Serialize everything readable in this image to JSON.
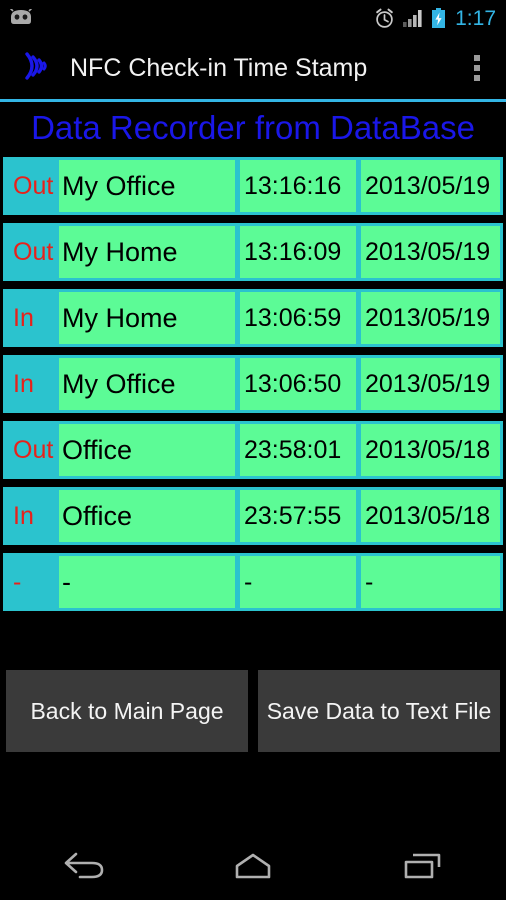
{
  "status_bar": {
    "notification_icon": "android-robot-icon",
    "alarm_icon": "alarm-clock-icon",
    "signal_icon": "signal-bars-icon",
    "battery_icon": "battery-charging-icon",
    "clock": "1:17",
    "clock_color": "#33B5E5"
  },
  "action_bar": {
    "app_icon": "nfc-wave-icon",
    "title": "NFC Check-in Time Stamp",
    "overflow_icon": "overflow-menu-icon",
    "divider_color": "#33B5E5"
  },
  "page": {
    "title": "Data Recorder from DataBase",
    "title_color": "#1A17E8",
    "row_background": "#2BC3CE",
    "cell_background": "#5CFB96",
    "direction_color": "#E8211B"
  },
  "table": {
    "rows": [
      {
        "direction": "Out",
        "place": "My Office",
        "time": "13:16:16",
        "date": "2013/05/19"
      },
      {
        "direction": "Out",
        "place": "My Home",
        "time": "13:16:09",
        "date": "2013/05/19"
      },
      {
        "direction": "In",
        "place": "My Home",
        "time": "13:06:59",
        "date": "2013/05/19"
      },
      {
        "direction": "In",
        "place": "My Office",
        "time": "13:06:50",
        "date": "2013/05/19"
      },
      {
        "direction": "Out",
        "place": "Office",
        "time": "23:58:01",
        "date": "2013/05/18"
      },
      {
        "direction": "In",
        "place": "Office",
        "time": "23:57:55",
        "date": "2013/05/18"
      },
      {
        "direction": "-",
        "place": "-",
        "time": "-",
        "date": "-"
      }
    ]
  },
  "buttons": {
    "back_to_main": "Back to Main Page",
    "save_to_text": "Save Data to Text File"
  },
  "nav_bar": {
    "back_icon": "back-arrow-icon",
    "home_icon": "home-icon",
    "recents_icon": "recent-apps-icon"
  }
}
